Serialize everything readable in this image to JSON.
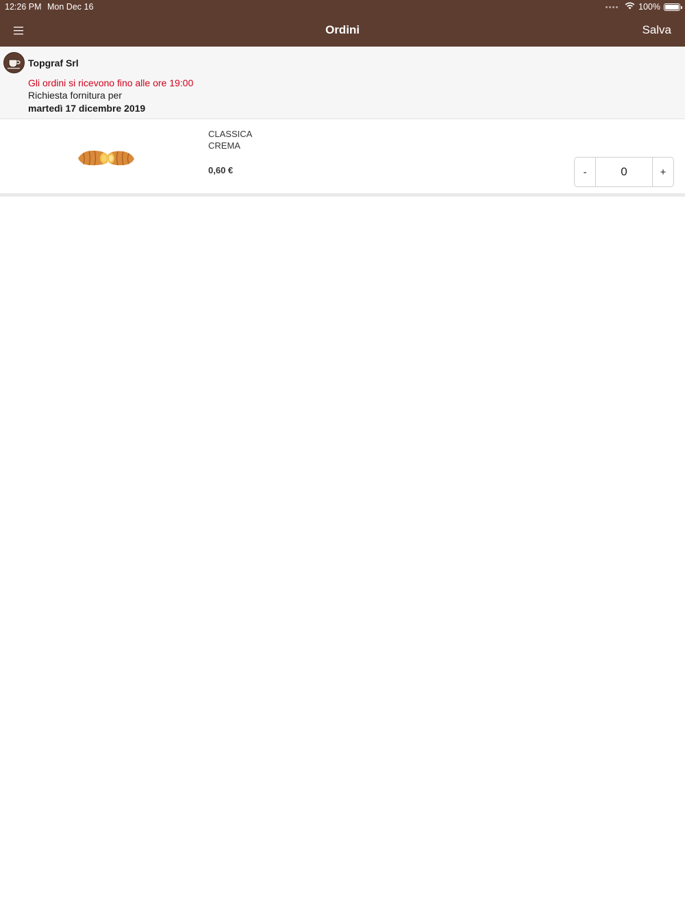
{
  "status_bar": {
    "time": "12:26 PM",
    "date": "Mon Dec 16",
    "battery_text": "100%",
    "battery_level": 1.0,
    "icons": [
      "signal-dots-icon",
      "wifi-icon",
      "battery-icon"
    ]
  },
  "nav": {
    "title": "Ordini",
    "save_label": "Salva",
    "menu_icon": "hamburger-menu-icon"
  },
  "customer": {
    "avatar_icon": "coffee-cup-icon",
    "name": "Topgraf Srl",
    "deadline": "Gli ordini si ricevono fino alle ore 19:00",
    "request_label": "Richiesta fornitura per",
    "delivery_date": "martedì 17 dicembre 2019"
  },
  "products": [
    {
      "image_icon": "croissant-image",
      "name_line1": "CLASSICA",
      "name_line2": "CREMA",
      "price": "0,60 €",
      "quantity": "0",
      "decrement_label": "-",
      "increment_label": "+"
    }
  ],
  "colors": {
    "brand_brown": "#5e3d31",
    "deadline_red": "#d0021b",
    "info_background": "#f6f6f6"
  }
}
